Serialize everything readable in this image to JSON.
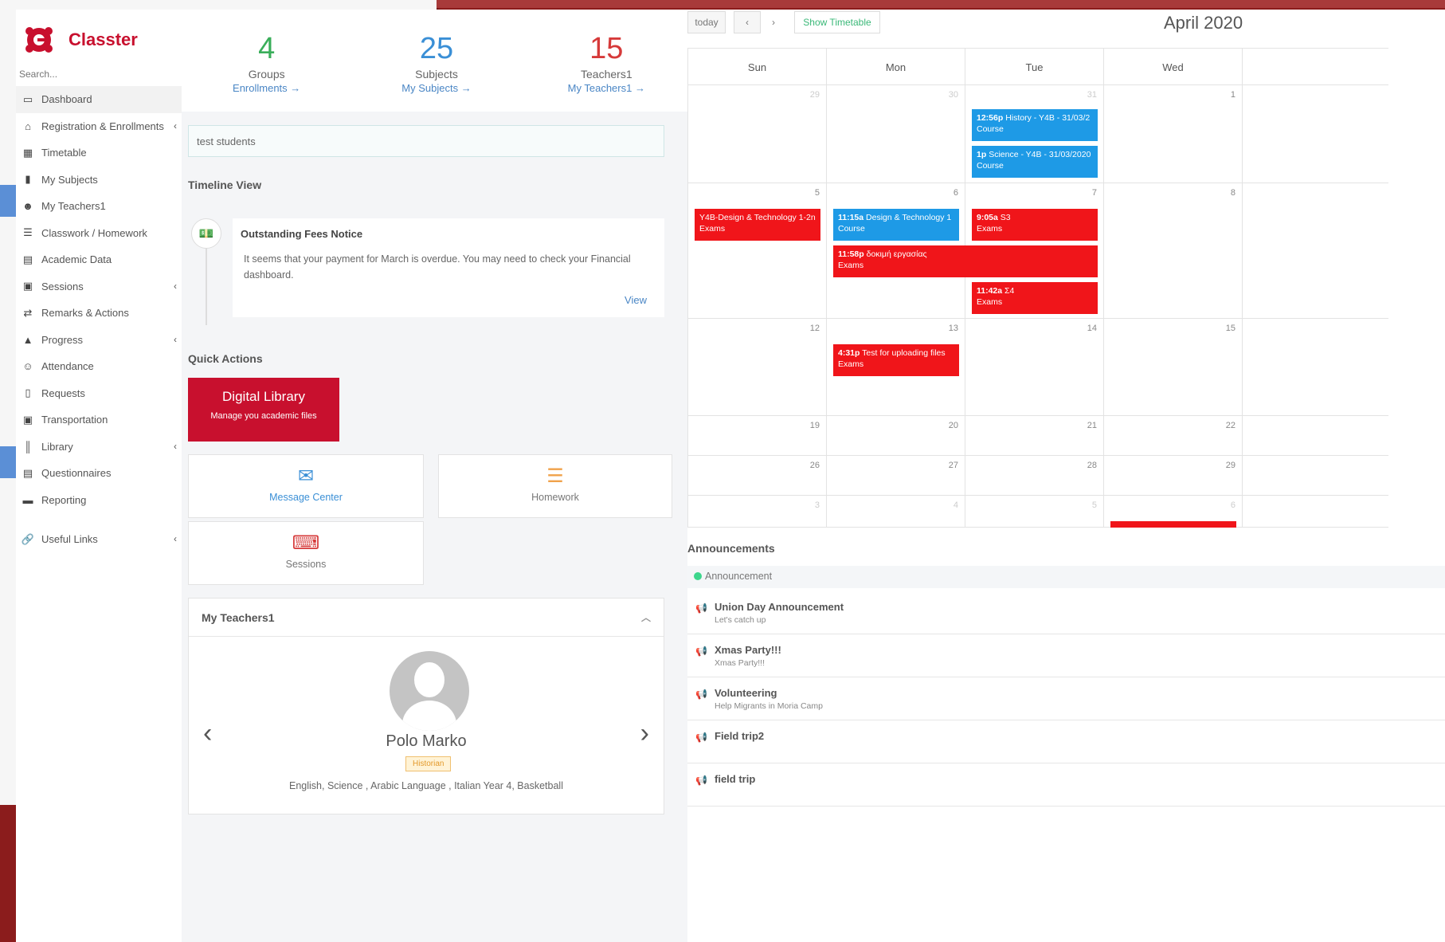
{
  "app": {
    "name": "Classter"
  },
  "colors": {
    "brand": "#c8102e",
    "event_blue": "#1e9ae6",
    "event_red": "#f0151a",
    "link": "#4a86c5",
    "groups_color": "#3aae5a",
    "subjects_color": "#3a8fd6",
    "teachers_color": "#d63a3a"
  },
  "sidebar": {
    "search_placeholder": "Search...",
    "items": [
      {
        "label": "Dashboard",
        "icon": "monitor-icon",
        "chevron": false
      },
      {
        "label": "Registration & Enrollments",
        "icon": "institution-icon",
        "chevron": true
      },
      {
        "label": "Timetable",
        "icon": "calendar-icon",
        "chevron": false
      },
      {
        "label": "My Subjects",
        "icon": "book-icon",
        "chevron": false
      },
      {
        "label": "My Teachers1",
        "icon": "users-icon",
        "chevron": false
      },
      {
        "label": "Classwork / Homework",
        "icon": "list-icon",
        "chevron": false
      },
      {
        "label": "Academic Data",
        "icon": "chart-icon",
        "chevron": false
      },
      {
        "label": "Sessions",
        "icon": "presentation-icon",
        "chevron": true
      },
      {
        "label": "Remarks & Actions",
        "icon": "shuffle-icon",
        "chevron": false
      },
      {
        "label": "Progress",
        "icon": "graduation-cap-icon",
        "chevron": true
      },
      {
        "label": "Attendance",
        "icon": "user-check-icon",
        "chevron": false
      },
      {
        "label": "Requests",
        "icon": "document-icon",
        "chevron": false
      },
      {
        "label": "Transportation",
        "icon": "bus-icon",
        "chevron": false
      },
      {
        "label": "Library",
        "icon": "library-icon",
        "chevron": true
      },
      {
        "label": "Questionnaires",
        "icon": "form-icon",
        "chevron": false
      },
      {
        "label": "Reporting",
        "icon": "printer-icon",
        "chevron": false
      }
    ],
    "useful_links": {
      "label": "Useful Links",
      "icon": "link-icon"
    }
  },
  "stats": [
    {
      "number": "4",
      "label": "Groups",
      "link": "Enrollments"
    },
    {
      "number": "25",
      "label": "Subjects",
      "link": "My Subjects"
    },
    {
      "number": "15",
      "label": "Teachers1",
      "link": "My Teachers1"
    }
  ],
  "notice_bar": {
    "value": "test students"
  },
  "timeline": {
    "title": "Timeline View",
    "card_title": "Outstanding Fees Notice",
    "card_body": "It seems that your payment for March is overdue. You may need to check your Financial dashboard.",
    "card_link": "View"
  },
  "quick_actions": {
    "title": "Quick Actions",
    "digital_library": {
      "title": "Digital Library",
      "subtitle": "Manage you academic files"
    },
    "message_center": "Message Center",
    "homework": "Homework",
    "sessions": "Sessions"
  },
  "teachers": {
    "title": "My Teachers1",
    "name": "Polo Marko",
    "badge": "Historian",
    "subjects": "English, Science , Arabic Language , Italian Year 4, Basketball"
  },
  "calendar": {
    "today_label": "today",
    "prev": "‹",
    "next": "›",
    "show_timetable": "Show Timetable",
    "title": "April 2020",
    "days": [
      "Sun",
      "Mon",
      "Tue",
      "Wed"
    ],
    "weeks": [
      {
        "dates": [
          "29",
          "30",
          "31",
          "1"
        ],
        "other": [
          true,
          true,
          true,
          false
        ]
      },
      {
        "dates": [
          "5",
          "6",
          "7",
          "8"
        ],
        "other": [
          false,
          false,
          false,
          false
        ]
      },
      {
        "dates": [
          "12",
          "13",
          "14",
          "15"
        ],
        "other": [
          false,
          false,
          false,
          false
        ]
      },
      {
        "dates": [
          "19",
          "20",
          "21",
          "22"
        ],
        "other": [
          false,
          false,
          false,
          false
        ]
      },
      {
        "dates": [
          "26",
          "27",
          "28",
          "29"
        ],
        "other": [
          false,
          false,
          false,
          false
        ]
      },
      {
        "dates": [
          "3",
          "4",
          "5",
          "6"
        ],
        "other": [
          true,
          true,
          true,
          true
        ]
      }
    ],
    "events": [
      {
        "time": "12:56p",
        "title": "History - Y4B - 31/03/2",
        "type": "Course",
        "color": "blue"
      },
      {
        "time": "1p",
        "title": "Science - Y4B - 31/03/2020",
        "type": "Course",
        "color": "blue"
      },
      {
        "time": "",
        "title": "Y4B-Design & Technology 1-2n",
        "type": "Exams",
        "color": "red"
      },
      {
        "time": "11:15a",
        "title": "Design & Technology 1",
        "type": "Course",
        "color": "blue"
      },
      {
        "time": "9:05a",
        "title": "S3",
        "type": "Exams",
        "color": "red"
      },
      {
        "time": "11:58p",
        "title": "δοκιμή εργασίας",
        "type": "Exams",
        "color": "red"
      },
      {
        "time": "11:42a",
        "title": "Σ4",
        "type": "Exams",
        "color": "red"
      },
      {
        "time": "4:31p",
        "title": "Test for uploading files",
        "type": "Exams",
        "color": "red"
      }
    ]
  },
  "announcements": {
    "title": "Announcements",
    "legend": "Announcement",
    "items": [
      {
        "title": "Union Day Announcement",
        "subtitle": "Let's catch up"
      },
      {
        "title": "Xmas Party!!!",
        "subtitle": "Xmas Party!!!"
      },
      {
        "title": "Volunteering",
        "subtitle": "Help Migrants in Moria Camp"
      },
      {
        "title": "Field trip2",
        "subtitle": ""
      },
      {
        "title": "field trip",
        "subtitle": ""
      }
    ]
  }
}
